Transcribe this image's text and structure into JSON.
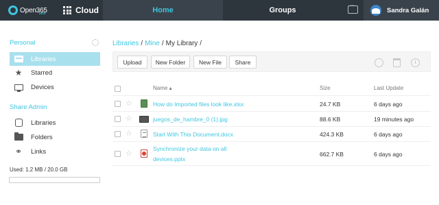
{
  "topbar": {
    "logo_text": "Open365",
    "logo_badge": "beta",
    "app_label": "Cloud",
    "nav": {
      "home": "Home",
      "groups": "Groups"
    },
    "user_name": "Sandra Galán"
  },
  "sidebar": {
    "personal_heading": "Personal",
    "personal_items": [
      {
        "label": "Libraries",
        "icon": "library-icon",
        "active": true
      },
      {
        "label": "Starred",
        "icon": "star-icon",
        "active": false
      },
      {
        "label": "Devices",
        "icon": "monitor-icon",
        "active": false
      }
    ],
    "share_admin_heading": "Share Admin",
    "share_admin_items": [
      {
        "label": "Libraries",
        "icon": "database-icon"
      },
      {
        "label": "Folders",
        "icon": "folder-icon"
      },
      {
        "label": "Links",
        "icon": "link-icon"
      }
    ],
    "usage_text": "Used: 1.2 MB / 20.0 GB",
    "usage_fraction": 0.0001
  },
  "breadcrumb": {
    "libraries": "Libraries",
    "mine": "Mine",
    "current": "My Library",
    "separator": "/"
  },
  "toolbar": {
    "upload": "Upload",
    "new_folder": "New Folder",
    "new_file": "New File",
    "share": "Share"
  },
  "table": {
    "columns": {
      "name": "Name ▴",
      "size": "Size",
      "last_update": "Last Update"
    },
    "rows": [
      {
        "name": "How do Imported files look like.xlsx",
        "size": "24.7 KB",
        "updated": "6 days ago",
        "type": "xlsx"
      },
      {
        "name": "juegos_de_hambre_0 (1).jpg",
        "size": "88.6 KB",
        "updated": "19 minutes ago",
        "type": "jpg"
      },
      {
        "name": "Start With This Document.docx",
        "size": "424.3 KB",
        "updated": "6 days ago",
        "type": "docx"
      },
      {
        "name_line1": "Synchronize your data on all",
        "name_line2": "devices.pptx",
        "size": "662.7 KB",
        "updated": "6 days ago",
        "type": "pptx"
      }
    ]
  },
  "colors": {
    "accent": "#3ec6e0",
    "topbar": "#2d353d",
    "active_item": "#a9e0ee"
  }
}
